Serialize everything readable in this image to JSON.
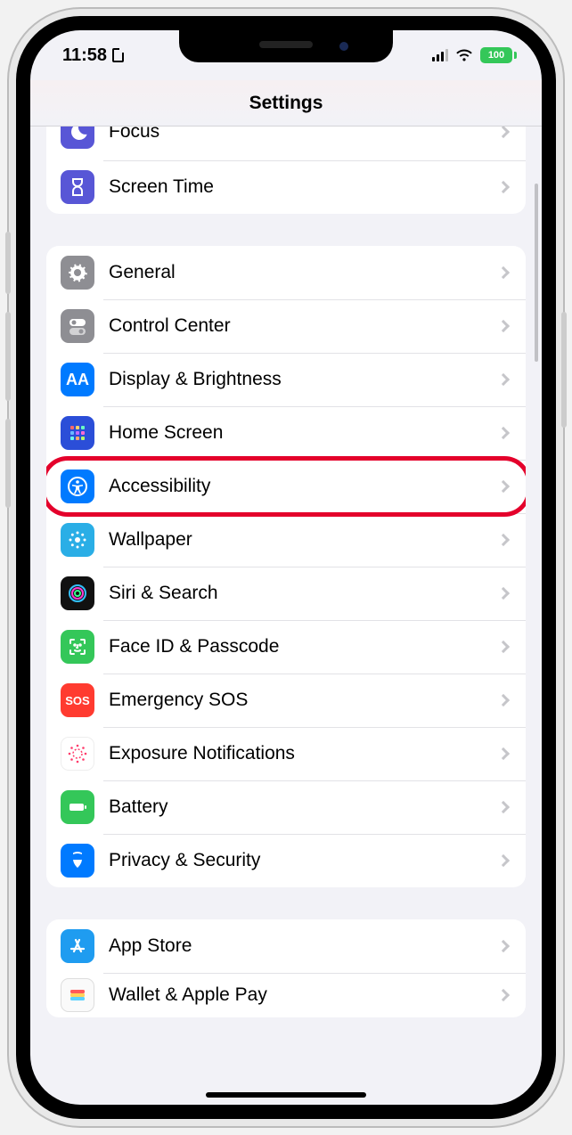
{
  "status": {
    "time": "11:58",
    "battery_pct": "100"
  },
  "header": {
    "title": "Settings"
  },
  "group0": {
    "focus": "Focus",
    "screentime": "Screen Time"
  },
  "group1": {
    "general": "General",
    "controlcenter": "Control Center",
    "display": "Display & Brightness",
    "homescreen": "Home Screen",
    "accessibility": "Accessibility",
    "wallpaper": "Wallpaper",
    "siri": "Siri & Search",
    "faceid": "Face ID & Passcode",
    "sos": "Emergency SOS",
    "sos_icon": "SOS",
    "exposure": "Exposure Notifications",
    "battery": "Battery",
    "privacy": "Privacy & Security"
  },
  "group2": {
    "appstore": "App Store",
    "wallet": "Wallet & Apple Pay"
  },
  "highlight": "accessibility"
}
